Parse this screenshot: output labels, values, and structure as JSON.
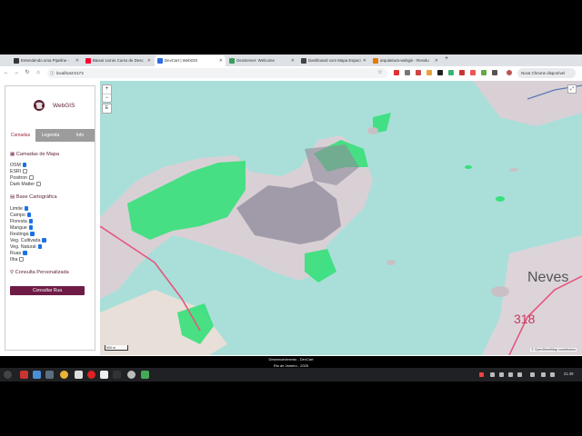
{
  "browser": {
    "tabs": [
      {
        "label": "Entendendo uma Pipeline - ",
        "fav_color": "#333333",
        "active": false
      },
      {
        "label": "Baixar Livros Curso de Desc",
        "fav_color": "#ff0033",
        "active": false
      },
      {
        "label": "DevCart | WebGIS",
        "fav_color": "#2d6cdf",
        "active": true
      },
      {
        "label": "GeoServer: Welcome",
        "fav_color": "#3a9d5d",
        "active": false
      },
      {
        "label": "Dashboard com Mapa Espaci",
        "fav_color": "#444444",
        "active": false
      },
      {
        "label": "arquitetura-webgis - Resolu",
        "fav_color": "#e07b00",
        "active": false
      }
    ],
    "url": "localhost:5173",
    "profile_label": "Nova Chrome disponível"
  },
  "panel": {
    "logo_text": "WebGIS",
    "tabs": [
      "Camadas",
      "Legenda",
      "Info"
    ],
    "map_layers_title": "Camadas de Mapa",
    "map_layers": [
      {
        "label": "OSM",
        "checked": true
      },
      {
        "label": "ESRI",
        "checked": false
      },
      {
        "label": "Positron",
        "checked": false
      },
      {
        "label": "Dark Matter",
        "checked": false
      }
    ],
    "base_title": "Base Cartográfica",
    "base_layers": [
      {
        "label": "Limite",
        "checked": true
      },
      {
        "label": "Campo",
        "checked": true
      },
      {
        "label": "Floresta",
        "checked": true
      },
      {
        "label": "Mangue",
        "checked": true
      },
      {
        "label": "Restinga",
        "checked": true
      },
      {
        "label": "Veg. Cultivada",
        "checked": true
      },
      {
        "label": "Veg. Natural",
        "checked": true
      },
      {
        "label": "Ruas",
        "checked": true
      },
      {
        "label": "Ilha",
        "checked": false
      }
    ],
    "query_title": "Consulta Personalizada",
    "query_button": "Consultar Rua"
  },
  "map": {
    "zoom_in": "+",
    "zoom_out": "−",
    "draw_tool": "E",
    "scale_label": "500 m",
    "place_label": "Neves",
    "road_number": "318",
    "attribution": "© OpenStreetMap contributors"
  },
  "footer": {
    "line1": "Desenvolvimento - DevCart",
    "line2": "Rio de Janeiro - 2025"
  },
  "taskbar": {
    "clock": "21:49"
  }
}
